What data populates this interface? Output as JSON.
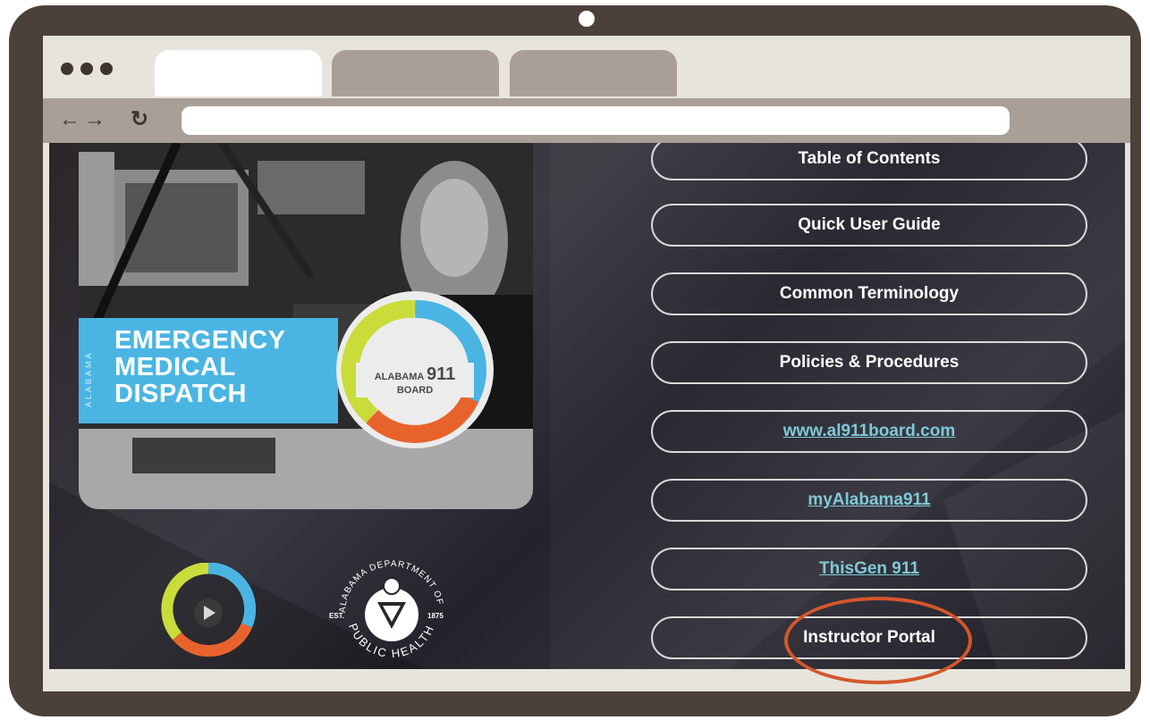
{
  "hero": {
    "state_side_label": "ALABAMA",
    "title_lines": [
      "EMERGENCY",
      "MEDICAL",
      "DISPATCH"
    ],
    "badge_left": "ALABAMA",
    "badge_number": "911",
    "badge_right": "BOARD"
  },
  "menu": {
    "items": [
      {
        "label": "Table of Contents",
        "type": "button"
      },
      {
        "label": "Quick User Guide",
        "type": "button"
      },
      {
        "label": "Common Terminology",
        "type": "button"
      },
      {
        "label": "Policies & Procedures",
        "type": "button"
      },
      {
        "label": "www.al911board.com",
        "type": "link"
      },
      {
        "label": "myAlabama911",
        "type": "link"
      },
      {
        "label": "ThisGen 911",
        "type": "link"
      },
      {
        "label": "Instructor Portal",
        "type": "button"
      }
    ]
  },
  "seal": {
    "top_text": "ALABAMA DEPARTMENT OF",
    "bottom_text": "PUBLIC HEALTH",
    "est_label": "EST.",
    "year": "1875"
  },
  "colors": {
    "frame": "#4c403a",
    "banner_blue": "#4ab5e3",
    "link_teal": "#7fc9d6",
    "highlight_orange": "#d4572b"
  }
}
